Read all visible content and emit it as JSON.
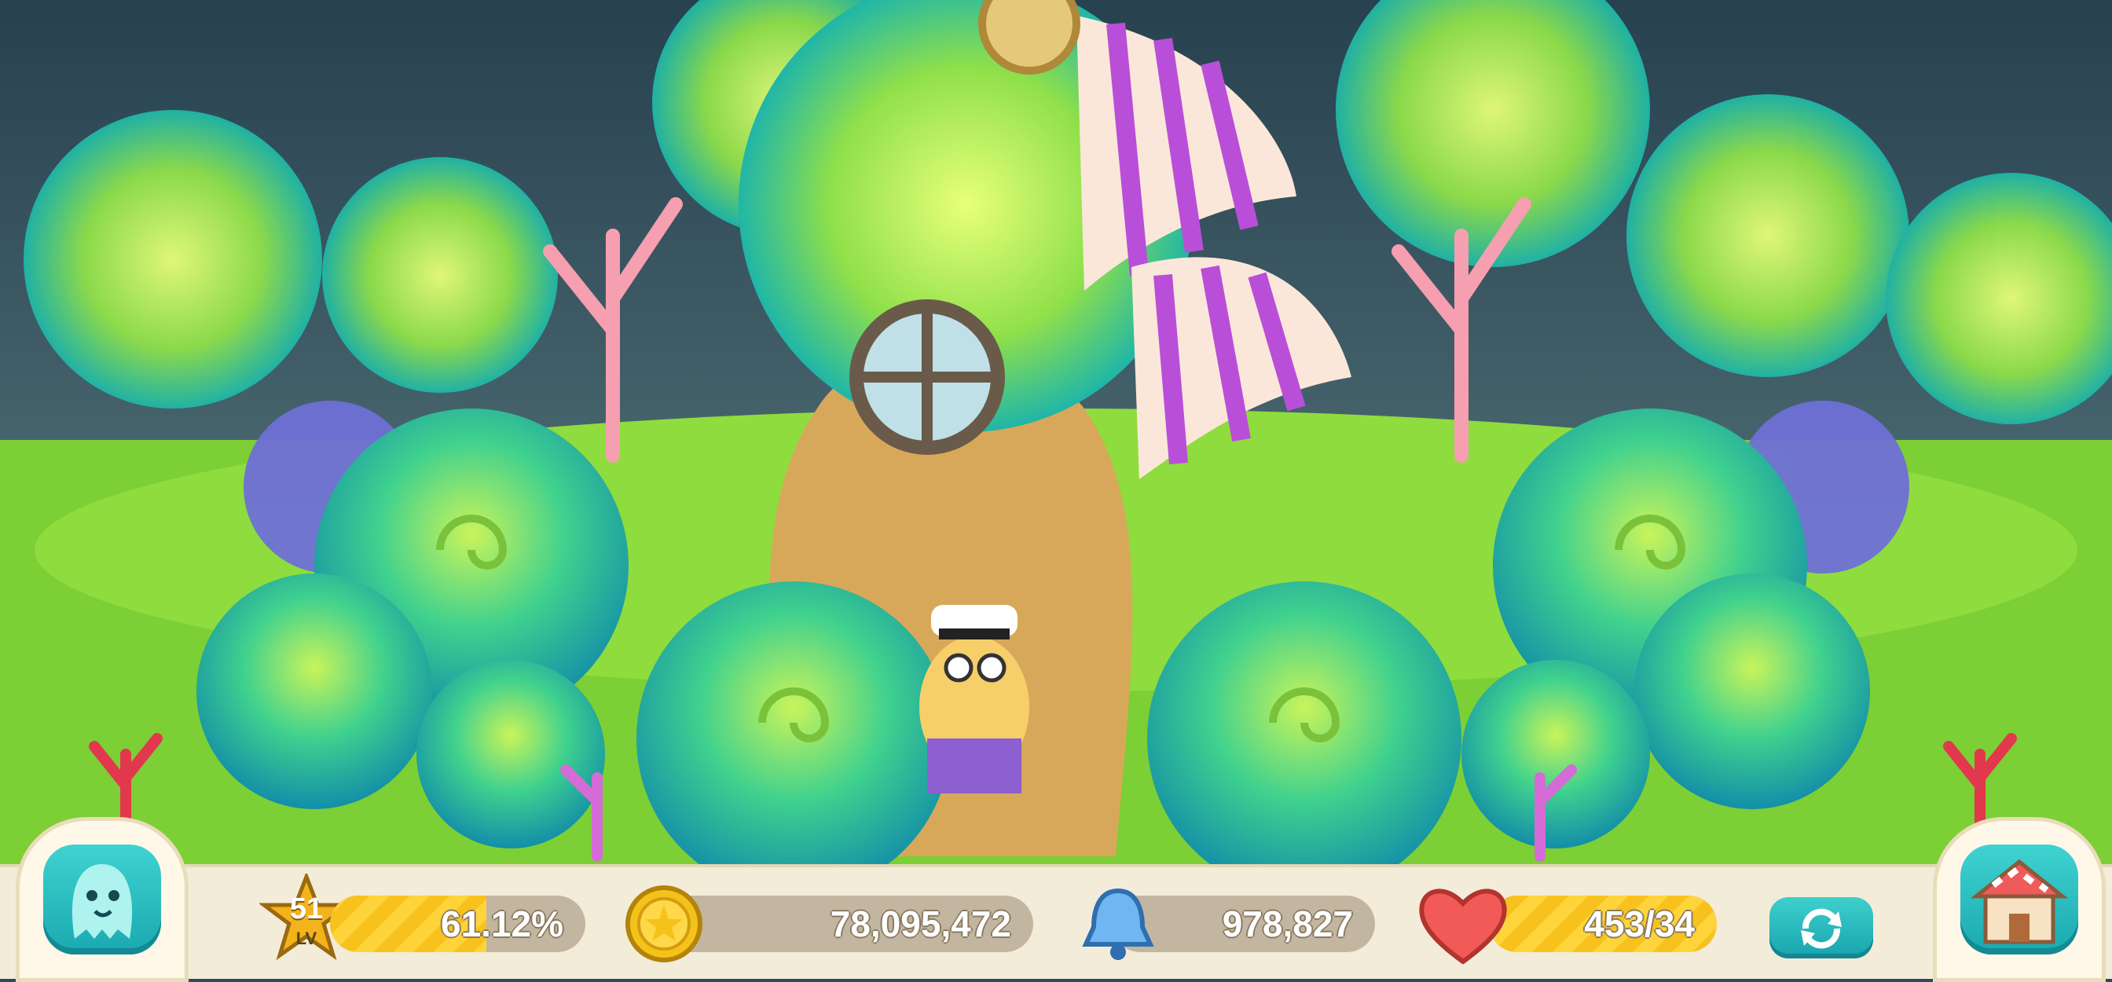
{
  "hud": {
    "level": "51",
    "level_unit": "LV",
    "xp_percent_label": "61.12%",
    "xp_fraction": 0.6112,
    "coins": "78,095,472",
    "bells": "978,827",
    "hearts": "453/34"
  },
  "icons": {
    "friends": "ghost-face-icon",
    "level": "star-badge-icon",
    "coin": "gold-coin-icon",
    "bell": "blue-bell-icon",
    "heart": "heart-icon",
    "refresh": "refresh-icon",
    "shop": "shop-house-icon"
  },
  "colors": {
    "accent_teal": "#22b3b8",
    "gold": "#ffd43a",
    "heart_red": "#f15a56",
    "hud_bg": "#f3ecd9"
  }
}
